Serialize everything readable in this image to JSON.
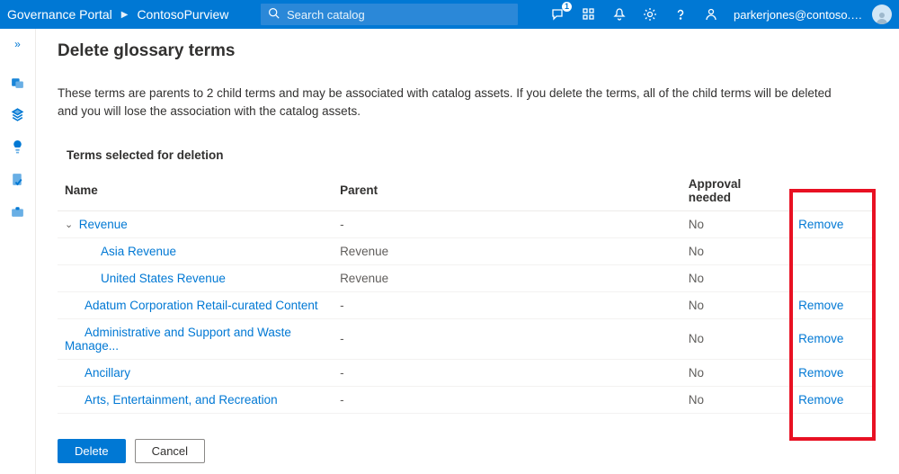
{
  "header": {
    "breadcrumb": [
      "Governance Portal",
      "ContosoPurview"
    ],
    "search_placeholder": "Search catalog",
    "chat_badge": "1",
    "user_email": "parkerjones@contoso.c..."
  },
  "page": {
    "title": "Delete glossary terms",
    "warning": "These terms are parents to 2 child terms and may be associated with catalog assets. If you delete the terms, all of the child terms will be deleted and you will lose the association with the catalog assets.",
    "subheading": "Terms selected for deletion",
    "columns": {
      "name": "Name",
      "parent": "Parent",
      "approval": "Approval needed"
    },
    "remove_label": "Remove",
    "rows": [
      {
        "name": "Revenue",
        "parent": "-",
        "approval": "No",
        "indent": 0,
        "expandable": true,
        "removable": true
      },
      {
        "name": "Asia Revenue",
        "parent": "Revenue",
        "approval": "No",
        "indent": 1,
        "expandable": false,
        "removable": false
      },
      {
        "name": "United States Revenue",
        "parent": "Revenue",
        "approval": "No",
        "indent": 1,
        "expandable": false,
        "removable": false
      },
      {
        "name": "Adatum Corporation Retail-curated Content",
        "parent": "-",
        "approval": "No",
        "indent": 0,
        "expandable": false,
        "removable": true
      },
      {
        "name": "Administrative and Support and Waste Manage...",
        "parent": "-",
        "approval": "No",
        "indent": 0,
        "expandable": false,
        "removable": true
      },
      {
        "name": "Ancillary",
        "parent": "-",
        "approval": "No",
        "indent": 0,
        "expandable": false,
        "removable": true
      },
      {
        "name": "Arts, Entertainment, and Recreation",
        "parent": "-",
        "approval": "No",
        "indent": 0,
        "expandable": false,
        "removable": true
      }
    ]
  },
  "footer": {
    "delete": "Delete",
    "cancel": "Cancel"
  }
}
